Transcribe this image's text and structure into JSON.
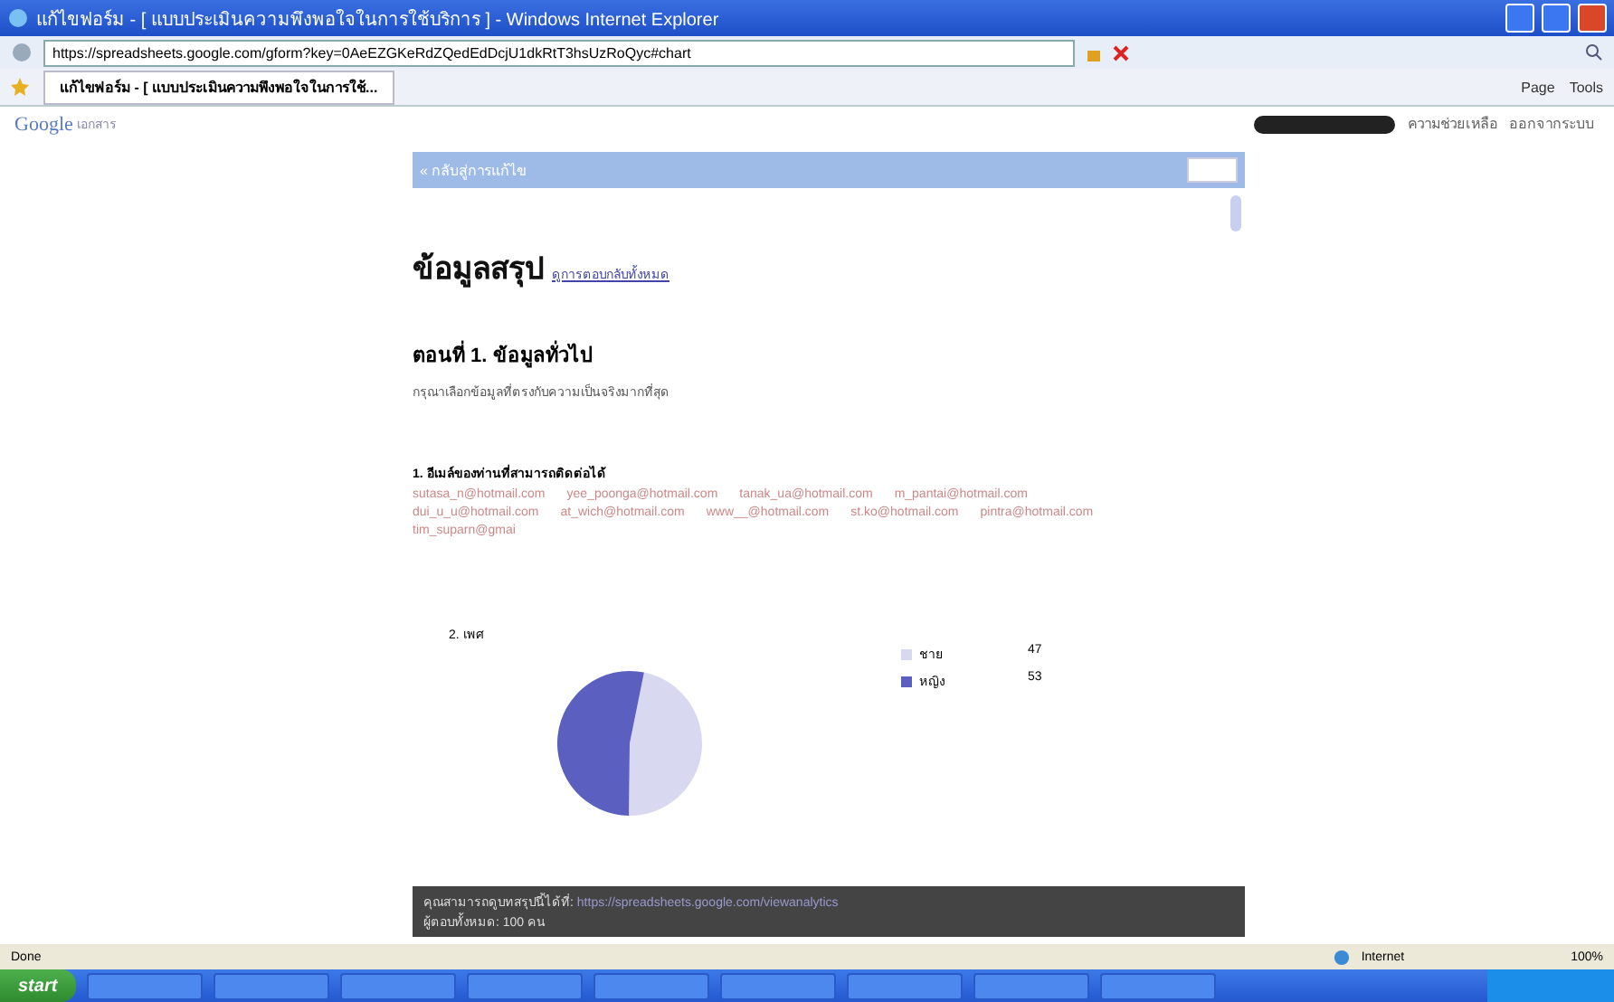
{
  "window": {
    "title": "แก้ไขฟอร์ม - [ แบบประเมินความพึงพอใจในการใช้บริการ ] - Windows Internet Explorer"
  },
  "address_bar": {
    "url": "https://spreadsheets.google.com/gform?key=0AeEZGKeRdZQedEdDcjU1dkRtT3hsUzRoQyc#chart"
  },
  "tab": {
    "label": "แก้ไขฟอร์ม - [ แบบประเมินความพึงพอใจในการใช้...",
    "selected": true
  },
  "command_bar": [
    "Page",
    "Tools"
  ],
  "header": {
    "logo": "Google",
    "logo_suffix": "เอกสาร",
    "links": [
      "ความช่วยเหลือ",
      "ออกจากระบบ"
    ]
  },
  "toolbar": {
    "back_link": "« กลับสู่การแก้ไข"
  },
  "summary": {
    "title": "ข้อมูลสรุป",
    "link": "ดูการตอบกลับทั้งหมด",
    "section_title": "ตอนที่ 1. ข้อมูลทั่วไป",
    "section_desc": "กรุณาเลือกข้อมูลที่ตรงกับความเป็นจริงมากที่สุด",
    "question_1": "1. อีเมล์ของท่านที่สามารถติดต่อได้",
    "emails": [
      "sutasa_n@hotmail.com",
      "yee_poonga@hotmail.com",
      "tanak_ua@hotmail.com",
      "m_pantai@hotmail.com",
      "dui_u_u@hotmail.com",
      "at_wich@hotmail.com",
      "www__@hotmail.com",
      "st.ko@hotmail.com",
      "pintra@hotmail.com",
      "tim_suparn@gmai"
    ],
    "question_2": "2. เพศ",
    "legend": [
      {
        "label": "ชาย",
        "value": "47",
        "color": "#d8d8f0"
      },
      {
        "label": "หญิง",
        "value": "53",
        "color": "#5a5fc0"
      }
    ]
  },
  "notice": {
    "text": "คุณสามารถดูบทสรุปนี้ได้ที่:",
    "link": "https://spreadsheets.google.com/viewanalytics",
    "text2": "ผู้ตอบทั้งหมด: 100 คน"
  },
  "status_bar": {
    "status": "Done",
    "zone": "Internet",
    "zoom": "100%"
  },
  "taskbar": {
    "start": "start"
  }
}
